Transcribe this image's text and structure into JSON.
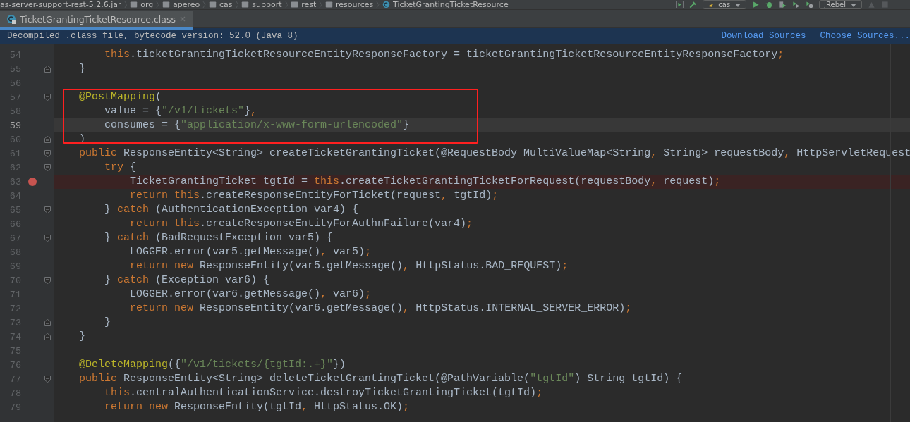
{
  "breadcrumbs": [
    {
      "kind": "jar",
      "label": "as-server-support-rest-5.2.6.jar"
    },
    {
      "kind": "folder",
      "label": "org"
    },
    {
      "kind": "folder",
      "label": "apereo"
    },
    {
      "kind": "folder",
      "label": "cas"
    },
    {
      "kind": "folder",
      "label": "support"
    },
    {
      "kind": "folder",
      "label": "rest"
    },
    {
      "kind": "folder",
      "label": "resources"
    },
    {
      "kind": "class",
      "label": "TicketGrantingTicketResource"
    }
  ],
  "toolbar": {
    "run_config": "cas",
    "rebel_config": "JRebel"
  },
  "tabs": [
    {
      "label": "TicketGrantingTicketResource.class",
      "selected": true
    }
  ],
  "banner": {
    "message": "Decompiled .class file, bytecode version: 52.0 (Java 8)",
    "links": [
      "Download Sources",
      "Choose Sources..."
    ]
  },
  "sections": [
    {
      "boxed": false,
      "lines": [
        {
          "number": "54",
          "current": false,
          "breakpoint": false,
          "tokens": [
            {
              "kind": "keyword",
              "text": "        this"
            },
            {
              "kind": "plain",
              "text": ".ticketGrantingTicketResourceEntityResponseFactory = ticketGrantingTicketResourceEntityResponseFactory"
            },
            {
              "kind": "punct",
              "text": ";"
            }
          ]
        },
        {
          "number": "55",
          "current": false,
          "breakpoint": false,
          "fold_marker": {
            "kind": "end"
          },
          "tokens": [
            {
              "kind": "plain",
              "text": "    }"
            }
          ]
        },
        {
          "number": "56",
          "current": false,
          "breakpoint": false
        }
      ]
    },
    {
      "boxed": true,
      "color": "#ff2020",
      "lines": [
        {
          "number": "57",
          "current": false,
          "breakpoint": false,
          "fold_marker": {
            "kind": "start"
          },
          "tokens": [
            {
              "kind": "annotation",
              "text": "    @PostMapping"
            },
            {
              "kind": "plain",
              "text": "("
            }
          ]
        },
        {
          "number": "58",
          "current": false,
          "breakpoint": false,
          "tokens": [
            {
              "kind": "plain",
              "text": "        value = {"
            },
            {
              "kind": "string",
              "text": "\"/v1/tickets\""
            },
            {
              "kind": "plain",
              "text": "}"
            },
            {
              "kind": "punct",
              "text": ","
            }
          ]
        },
        {
          "number": "59",
          "current": true,
          "breakpoint": false,
          "tokens": [
            {
              "kind": "plain",
              "text": "        consumes = {"
            },
            {
              "kind": "string",
              "text": "\"application/x-www-form-urlencoded\""
            },
            {
              "kind": "plain",
              "text": "}"
            }
          ]
        },
        {
          "number": "60",
          "current": false,
          "breakpoint": false,
          "fold_marker": {
            "kind": "end"
          },
          "tokens": [
            {
              "kind": "plain",
              "text": "    )"
            }
          ]
        }
      ]
    },
    {
      "boxed": false,
      "lines": [
        {
          "number": "61",
          "current": false,
          "breakpoint": false,
          "fold_marker": {
            "kind": "start"
          },
          "tokens": [
            {
              "kind": "keyword",
              "text": "    public"
            },
            {
              "kind": "plain",
              "text": " ResponseEntity<String> createTicketGrantingTicket(@RequestBody MultiValueMap<String"
            },
            {
              "kind": "punct",
              "text": ","
            },
            {
              "kind": "plain",
              "text": " String> requestBody"
            },
            {
              "kind": "punct",
              "text": ","
            },
            {
              "kind": "plain",
              "text": " HttpServletRequest"
            }
          ]
        },
        {
          "number": "62",
          "current": false,
          "breakpoint": false,
          "fold_marker": {
            "kind": "start"
          },
          "tokens": [
            {
              "kind": "keyword",
              "text": "        try"
            },
            {
              "kind": "plain",
              "text": " {"
            }
          ]
        },
        {
          "number": "63",
          "current": false,
          "breakpoint": true,
          "tokens": [
            {
              "kind": "plain",
              "text": "            TicketGrantingTicket tgtId = "
            },
            {
              "kind": "keyword",
              "text": "this"
            },
            {
              "kind": "plain",
              "text": ".createTicketGrantingTicketForRequest(requestBody"
            },
            {
              "kind": "punct",
              "text": ","
            },
            {
              "kind": "plain",
              "text": " request)"
            },
            {
              "kind": "punct",
              "text": ";"
            }
          ]
        },
        {
          "number": "64",
          "current": false,
          "breakpoint": false,
          "tokens": [
            {
              "kind": "keyword",
              "text": "            return this"
            },
            {
              "kind": "plain",
              "text": ".createResponseEntityForTicket(request"
            },
            {
              "kind": "punct",
              "text": ","
            },
            {
              "kind": "plain",
              "text": " tgtId)"
            },
            {
              "kind": "punct",
              "text": ";"
            }
          ]
        },
        {
          "number": "65",
          "current": false,
          "breakpoint": false,
          "fold_marker": {
            "kind": "start"
          },
          "tokens": [
            {
              "kind": "plain",
              "text": "        } "
            },
            {
              "kind": "keyword",
              "text": "catch"
            },
            {
              "kind": "plain",
              "text": " (AuthenticationException var4) {"
            }
          ]
        },
        {
          "number": "66",
          "current": false,
          "breakpoint": false,
          "tokens": [
            {
              "kind": "keyword",
              "text": "            return this"
            },
            {
              "kind": "plain",
              "text": ".createResponseEntityForAuthnFailure(var4)"
            },
            {
              "kind": "punct",
              "text": ";"
            }
          ]
        },
        {
          "number": "67",
          "current": false,
          "breakpoint": false,
          "fold_marker": {
            "kind": "start"
          },
          "tokens": [
            {
              "kind": "plain",
              "text": "        } "
            },
            {
              "kind": "keyword",
              "text": "catch"
            },
            {
              "kind": "plain",
              "text": " (BadRequestException var5) {"
            }
          ]
        },
        {
          "number": "68",
          "current": false,
          "breakpoint": false,
          "tokens": [
            {
              "kind": "plain",
              "text": "            LOGGER.error(var5.getMessage()"
            },
            {
              "kind": "punct",
              "text": ","
            },
            {
              "kind": "plain",
              "text": " var5)"
            },
            {
              "kind": "punct",
              "text": ";"
            }
          ]
        },
        {
          "number": "69",
          "current": false,
          "breakpoint": false,
          "tokens": [
            {
              "kind": "keyword",
              "text": "            return new"
            },
            {
              "kind": "plain",
              "text": " ResponseEntity(var5.getMessage()"
            },
            {
              "kind": "punct",
              "text": ","
            },
            {
              "kind": "plain",
              "text": " HttpStatus.BAD_REQUEST)"
            },
            {
              "kind": "punct",
              "text": ";"
            }
          ]
        },
        {
          "number": "70",
          "current": false,
          "breakpoint": false,
          "fold_marker": {
            "kind": "start"
          },
          "tokens": [
            {
              "kind": "plain",
              "text": "        } "
            },
            {
              "kind": "keyword",
              "text": "catch"
            },
            {
              "kind": "plain",
              "text": " (Exception var6) {"
            }
          ]
        },
        {
          "number": "71",
          "current": false,
          "breakpoint": false,
          "tokens": [
            {
              "kind": "plain",
              "text": "            LOGGER.error(var6.getMessage()"
            },
            {
              "kind": "punct",
              "text": ","
            },
            {
              "kind": "plain",
              "text": " var6)"
            },
            {
              "kind": "punct",
              "text": ";"
            }
          ]
        },
        {
          "number": "72",
          "current": false,
          "breakpoint": false,
          "tokens": [
            {
              "kind": "keyword",
              "text": "            return new"
            },
            {
              "kind": "plain",
              "text": " ResponseEntity(var6.getMessage()"
            },
            {
              "kind": "punct",
              "text": ","
            },
            {
              "kind": "plain",
              "text": " HttpStatus.INTERNAL_SERVER_ERROR)"
            },
            {
              "kind": "punct",
              "text": ";"
            }
          ]
        },
        {
          "number": "73",
          "current": false,
          "breakpoint": false,
          "fold_marker": {
            "kind": "end"
          },
          "tokens": [
            {
              "kind": "plain",
              "text": "        }"
            }
          ]
        },
        {
          "number": "74",
          "current": false,
          "breakpoint": false,
          "fold_marker": {
            "kind": "end"
          },
          "tokens": [
            {
              "kind": "plain",
              "text": "    }"
            }
          ]
        },
        {
          "number": "75",
          "current": false,
          "breakpoint": false
        },
        {
          "number": "76",
          "current": false,
          "breakpoint": false,
          "tokens": [
            {
              "kind": "annotation",
              "text": "    @DeleteMapping"
            },
            {
              "kind": "plain",
              "text": "({"
            },
            {
              "kind": "string",
              "text": "\"/v1/tickets/{tgtId:.+}\""
            },
            {
              "kind": "plain",
              "text": "})"
            }
          ]
        },
        {
          "number": "77",
          "current": false,
          "breakpoint": false,
          "fold_marker": {
            "kind": "start"
          },
          "tokens": [
            {
              "kind": "keyword",
              "text": "    public"
            },
            {
              "kind": "plain",
              "text": " ResponseEntity<String> deleteTicketGrantingTicket(@PathVariable("
            },
            {
              "kind": "string",
              "text": "\"tgtId\""
            },
            {
              "kind": "plain",
              "text": ") String tgtId) {"
            }
          ]
        },
        {
          "number": "78",
          "current": false,
          "breakpoint": false,
          "tokens": [
            {
              "kind": "keyword",
              "text": "        this"
            },
            {
              "kind": "plain",
              "text": ".centralAuthenticationService.destroyTicketGrantingTicket(tgtId)"
            },
            {
              "kind": "punct",
              "text": ";"
            }
          ]
        },
        {
          "number": "79",
          "current": false,
          "breakpoint": false,
          "tokens": [
            {
              "kind": "keyword",
              "text": "        return new"
            },
            {
              "kind": "plain",
              "text": " ResponseEntity(tgtId"
            },
            {
              "kind": "punct",
              "text": ","
            },
            {
              "kind": "plain",
              "text": " HttpStatus.OK)"
            },
            {
              "kind": "punct",
              "text": ";"
            }
          ]
        }
      ]
    }
  ]
}
